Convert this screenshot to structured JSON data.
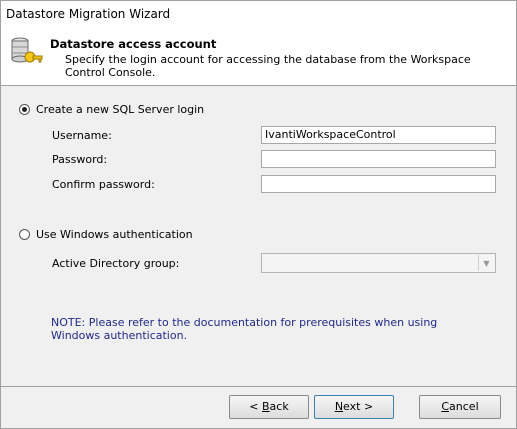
{
  "window": {
    "title": "Datastore Migration Wizard"
  },
  "header": {
    "title": "Datastore access account",
    "description": "Specify the login account for accessing the database from the Workspace Control Console.",
    "icon": "database-key-icon"
  },
  "sql_login": {
    "radio_label": "Create a new SQL Server login",
    "selected": true,
    "username_label": "Username:",
    "username_value": "IvantiWorkspaceControl",
    "password_label": "Password:",
    "password_value": "",
    "confirm_label": "Confirm password:",
    "confirm_value": ""
  },
  "windows_auth": {
    "radio_label": "Use Windows authentication",
    "selected": false,
    "ad_group_label": "Active Directory group:",
    "ad_group_value": ""
  },
  "note": "NOTE: Please refer to the documentation for prerequisites when using Windows authentication.",
  "buttons": {
    "back_pre": "< ",
    "back_key": "B",
    "back_post": "ack",
    "next_key": "N",
    "next_post": "ext >",
    "cancel_key": "C",
    "cancel_post": "ancel"
  },
  "colors": {
    "note_text": "#1f2a8a",
    "header_bg": "#ffffff",
    "dialog_bg": "#f0f0f0"
  }
}
